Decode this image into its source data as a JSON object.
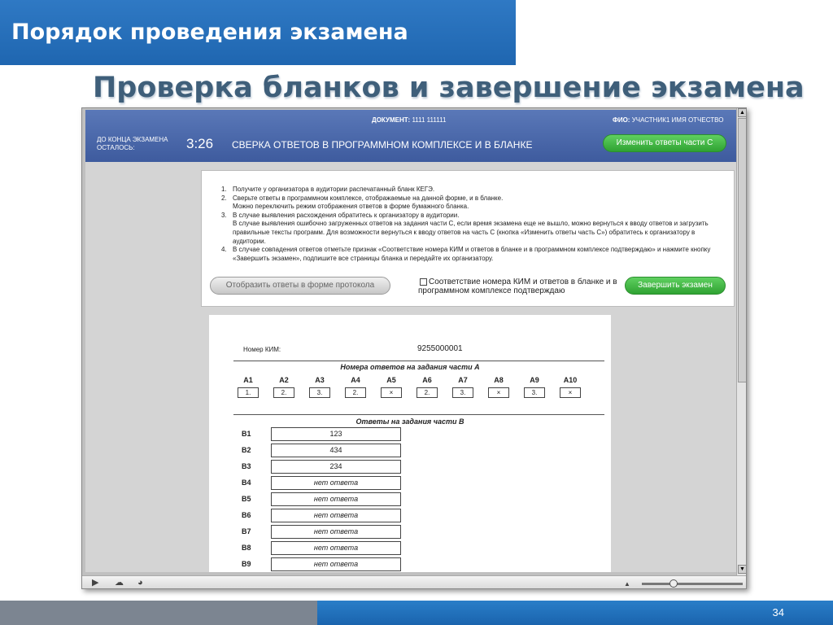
{
  "slide": {
    "header": "Порядок проведения экзамена",
    "subtitle": "Проверка бланков и завершение экзамена",
    "page_number": "34"
  },
  "app_header": {
    "document_label": "ДОКУМЕНТ:",
    "document_value": "1111 111111",
    "fio_label": "ФИО:",
    "fio_value": "УЧАСТНИК1 ИМЯ ОТЧЕСТВО",
    "time_label": "ДО КОНЦА ЭКЗАМЕНА ОСТАЛОСЬ:",
    "time_value": "3:26",
    "screen_title": "СВЕРКА ОТВЕТОВ В ПРОГРАММНОМ КОМПЛЕКСЕ И В БЛАНКЕ",
    "change_button": "Изменить ответы части С"
  },
  "instructions": [
    {
      "num": "1.",
      "text": "Получите у организатора в аудитории распечатанный бланк КЕГЭ."
    },
    {
      "num": "2.",
      "text": "Сверьте ответы в программном комплексе, отображаемые на данной форме, и в бланке."
    },
    {
      "num": "",
      "text": "Можно переключить режим отображения ответов в форме бумажного бланка."
    },
    {
      "num": "3.",
      "text": "В случае выявления расхождения обратитесь к организатору в аудитории."
    },
    {
      "num": "",
      "text": "В случае выявления ошибочно загруженных ответов на задания части С, если время экзамена еще не вышло, можно вернуться к вводу ответов и загрузить правильные тексты программ. Для возможности вернуться к вводу ответов на часть С (кнопка «Изменить ответы часть С») обратитесь к организатору в аудитории."
    },
    {
      "num": "4.",
      "text": "В случае совпадения ответов отметьте признак «Соответствие номера КИМ и ответов в бланке и в программном комплексе подтверждаю» и нажмите кнопку «Завершить экзамен», подпишите все страницы бланка и передайте их организатору."
    }
  ],
  "actions": {
    "protocol_button": "Отобразить ответы в форме протокола",
    "confirm_checkbox_label": "Соответствие номера КИМ и ответов в бланке и в программном комплексе подтверждаю",
    "finish_button": "Завершить экзамен"
  },
  "blank": {
    "kim_label": "Номер КИМ:",
    "kim_value": "9255000001",
    "part_a_title": "Номера ответов на задания части А",
    "part_a": [
      {
        "label": "A1",
        "value": "1."
      },
      {
        "label": "A2",
        "value": "2."
      },
      {
        "label": "A3",
        "value": "3."
      },
      {
        "label": "A4",
        "value": "2."
      },
      {
        "label": "A5",
        "value": "×"
      },
      {
        "label": "A6",
        "value": "2."
      },
      {
        "label": "A7",
        "value": "3."
      },
      {
        "label": "A8",
        "value": "×"
      },
      {
        "label": "A9",
        "value": "3."
      },
      {
        "label": "A10",
        "value": "×"
      }
    ],
    "part_b_title": "Ответы на задания части В",
    "part_b": [
      {
        "label": "B1",
        "value": "123"
      },
      {
        "label": "B2",
        "value": "434"
      },
      {
        "label": "B3",
        "value": "234"
      },
      {
        "label": "B4",
        "value": "нет ответа"
      },
      {
        "label": "B5",
        "value": "нет ответа"
      },
      {
        "label": "B6",
        "value": "нет ответа"
      },
      {
        "label": "B7",
        "value": "нет ответа"
      },
      {
        "label": "B8",
        "value": "нет ответа"
      },
      {
        "label": "B9",
        "value": "нет ответа"
      }
    ]
  },
  "icons": {
    "up_arrow": "▲",
    "down_arrow": "▼",
    "player": "▶",
    "cloud": "☁",
    "gauge": "◕",
    "triangle": "▲"
  }
}
